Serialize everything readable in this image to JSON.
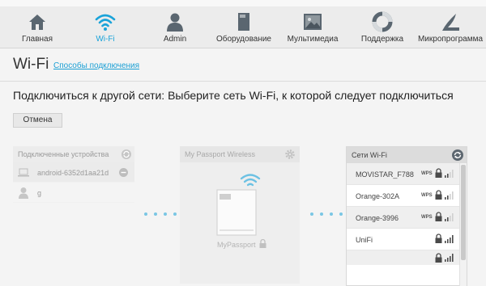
{
  "nav": {
    "items": [
      {
        "label": "Главная",
        "icon": "home-icon"
      },
      {
        "label": "Wi-Fi",
        "icon": "wifi-icon"
      },
      {
        "label": "Admin",
        "icon": "admin-icon"
      },
      {
        "label": "Оборудование",
        "icon": "hardware-icon"
      },
      {
        "label": "Мультимедиа",
        "icon": "multimedia-icon"
      },
      {
        "label": "Поддержка",
        "icon": "support-icon"
      },
      {
        "label": "Микропрограмма",
        "icon": "firmware-icon"
      }
    ],
    "active_index": 1
  },
  "page": {
    "title": "Wi-Fi",
    "connection_link": "Способы подключения",
    "heading": "Подключиться к другой сети: Выберите сеть Wi-Fi, к которой следует подключиться",
    "cancel_label": "Отмена"
  },
  "connected_devices": {
    "header": "Подключенные устройства",
    "devices": [
      {
        "name": "android-6352d1aa21d",
        "icon": "laptop-icon"
      },
      {
        "name": "g",
        "icon": "user-icon"
      }
    ]
  },
  "passport": {
    "header": "My Passport Wireless",
    "device_name": "MyPassport"
  },
  "wifi_networks": {
    "header": "Сети Wi-Fi",
    "networks": [
      {
        "name": "MOVISTAR_F788",
        "wps": "WPS",
        "locked": true,
        "signal": 2
      },
      {
        "name": "Orange-302A",
        "wps": "WPS",
        "locked": true,
        "signal": 2
      },
      {
        "name": "Orange-3996",
        "wps": "WPS",
        "locked": true,
        "signal": 2
      },
      {
        "name": "UniFi",
        "wps": "",
        "locked": true,
        "signal": 4
      },
      {
        "name": "",
        "wps": "",
        "locked": true,
        "signal": 4
      }
    ]
  },
  "colors": {
    "accent": "#1aa3d9",
    "nav_icon": "#5a6670",
    "dots": "#7ac6e4"
  }
}
